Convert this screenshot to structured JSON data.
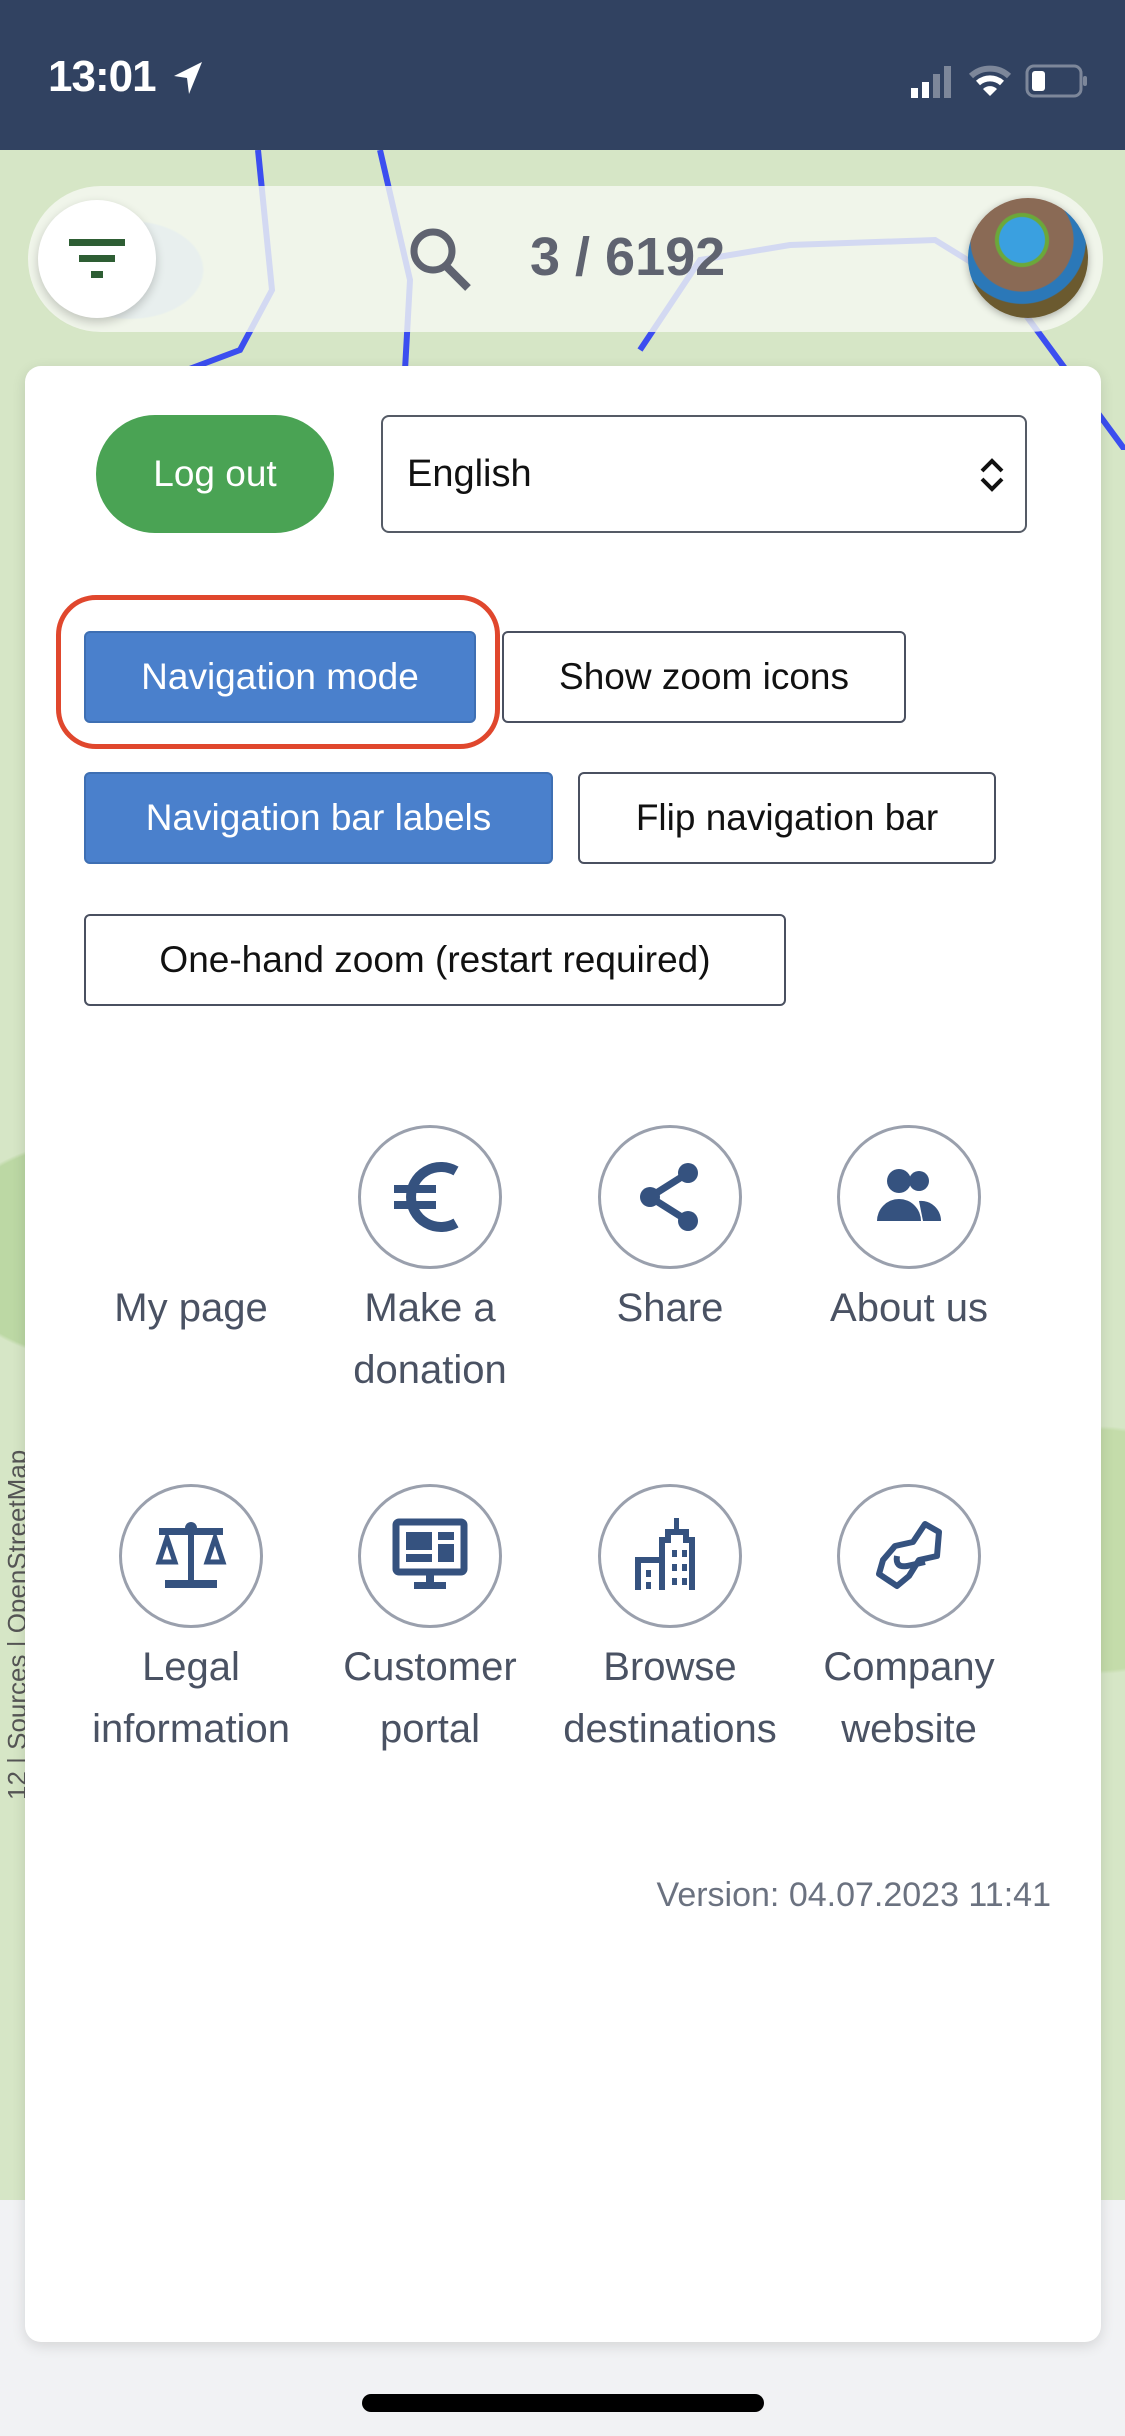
{
  "status_bar": {
    "time": "13:01"
  },
  "search_bar": {
    "result_count": "3 / 6192"
  },
  "settings": {
    "logout_label": "Log out",
    "language_value": "English",
    "toggles": [
      {
        "label": "Navigation mode",
        "active": true,
        "highlighted": true
      },
      {
        "label": "Show zoom icons",
        "active": false
      },
      {
        "label": "Navigation bar labels",
        "active": true
      },
      {
        "label": "Flip navigation bar",
        "active": false
      },
      {
        "label": "One-hand zoom (restart required)",
        "active": false
      }
    ]
  },
  "menu": [
    {
      "label": "My page",
      "icon": "avatar"
    },
    {
      "label": "Make a donation",
      "icon": "euro-icon"
    },
    {
      "label": "Share",
      "icon": "share-icon"
    },
    {
      "label": "About us",
      "icon": "users-icon"
    },
    {
      "label": "Legal information",
      "icon": "scale-icon"
    },
    {
      "label": "Customer portal",
      "icon": "monitor-icon"
    },
    {
      "label": "Browse destinations",
      "icon": "city-icon"
    },
    {
      "label": "Company website",
      "icon": "handshake-icon"
    }
  ],
  "version": "Version: 04.07.2023 11:41",
  "map_attribution": "12 | Sources | OpenStreetMap",
  "colors": {
    "status_bar": "#314261",
    "active": "#4a80cc",
    "logout": "#4aa354",
    "icon": "#35527f",
    "highlight": "#e0472d"
  }
}
